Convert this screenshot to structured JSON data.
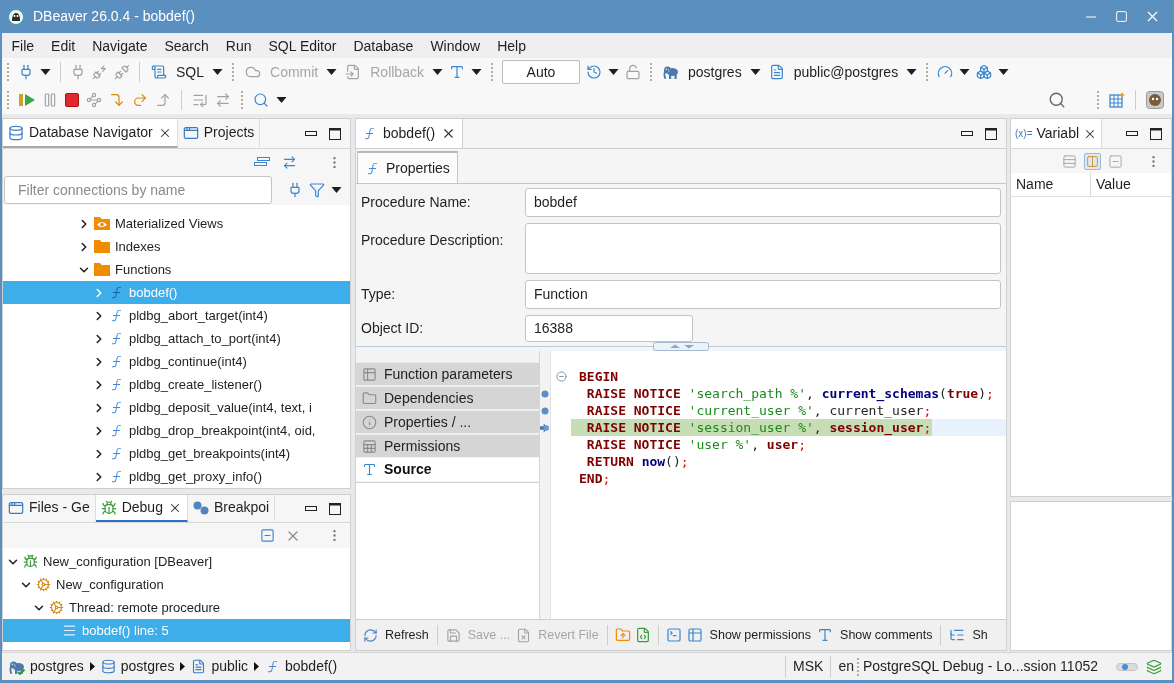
{
  "window": {
    "title": "DBeaver 26.0.4 - bobdef()"
  },
  "menu": [
    "File",
    "Edit",
    "Navigate",
    "Search",
    "Run",
    "SQL Editor",
    "Database",
    "Window",
    "Help"
  ],
  "toolbar": {
    "editor": {
      "label": "SQL"
    },
    "commit": {
      "label": "Commit",
      "disabled": true
    },
    "rollback": {
      "label": "Rollback",
      "disabled": true
    },
    "transaction_mode": {
      "value": "Auto"
    },
    "datasource": {
      "label": "postgres"
    },
    "schema": {
      "label": "public@postgres"
    }
  },
  "navigator": {
    "focused": false,
    "tabs": [
      {
        "label": "Database Navigator",
        "selected": true,
        "closable": true
      },
      {
        "label": "Projects",
        "selected": false,
        "closable": false
      }
    ],
    "filter": {
      "placeholder": "Filter connections by name"
    },
    "tree": [
      {
        "label": "Materialized Views",
        "kind": "view-folder",
        "expanded": false,
        "selected": false
      },
      {
        "label": "Indexes",
        "kind": "folder",
        "expanded": false,
        "selected": false
      },
      {
        "label": "Functions",
        "kind": "folder",
        "expanded": true,
        "selected": false,
        "children": [
          {
            "label": "bobdef()",
            "kind": "function",
            "expanded": false,
            "selected": true
          },
          {
            "label": "pldbg_abort_target(int4)",
            "kind": "function",
            "expanded": false,
            "selected": false
          },
          {
            "label": "pldbg_attach_to_port(int4)",
            "kind": "function",
            "expanded": false,
            "selected": false
          },
          {
            "label": "pldbg_continue(int4)",
            "kind": "function",
            "expanded": false,
            "selected": false
          },
          {
            "label": "pldbg_create_listener()",
            "kind": "function",
            "expanded": false,
            "selected": false
          },
          {
            "label": "pldbg_deposit_value(int4, text, i",
            "kind": "function",
            "expanded": false,
            "selected": false
          },
          {
            "label": "pldbg_drop_breakpoint(int4, oid,",
            "kind": "function",
            "expanded": false,
            "selected": false
          },
          {
            "label": "pldbg_get_breakpoints(int4)",
            "kind": "function",
            "expanded": false,
            "selected": false
          },
          {
            "label": "pldbg_get_proxy_info()",
            "kind": "function",
            "expanded": false,
            "selected": false
          }
        ]
      }
    ]
  },
  "debug": {
    "focused": true,
    "tabs": [
      {
        "label": "Files - Ge",
        "selected": false,
        "closable": false
      },
      {
        "label": "Debug",
        "selected": true,
        "closable": true
      },
      {
        "label": "Breakpoi",
        "selected": false,
        "closable": false
      }
    ],
    "tree": [
      {
        "label": "New_configuration [DBeaver]",
        "kind": "launch",
        "expanded": true,
        "selected": false,
        "children": [
          {
            "label": "New_configuration",
            "kind": "target",
            "expanded": true,
            "selected": false,
            "children": [
              {
                "label": "Thread: remote procedure",
                "kind": "thread",
                "expanded": true,
                "selected": false,
                "children": [
                  {
                    "label": "bobdef() line: 5",
                    "kind": "frame",
                    "selected": true
                  }
                ]
              }
            ]
          }
        ]
      }
    ]
  },
  "editor": {
    "tab": {
      "label": "bobdef()",
      "closable": true
    },
    "subtabs": [
      {
        "label": "Properties",
        "selected": true
      }
    ],
    "form": [
      {
        "label": "Procedure Name:",
        "kind": "text",
        "value": "bobdef"
      },
      {
        "label": "Procedure Description:",
        "kind": "textarea"
      },
      {
        "label": "Type:",
        "kind": "text",
        "value": "Function"
      },
      {
        "label": "Object ID:",
        "kind": "short",
        "value": "16388"
      }
    ],
    "sections": [
      {
        "label": "Function parameters",
        "kind": "parameters",
        "selected": false
      },
      {
        "label": "Dependencies",
        "kind": "dependencies",
        "selected": false
      },
      {
        "label": "Properties / ...",
        "kind": "properties",
        "selected": false
      },
      {
        "label": "Permissions",
        "kind": "permissions",
        "selected": false
      },
      {
        "label": "Source",
        "kind": "source",
        "selected": true
      }
    ],
    "code": [
      {
        "fold": true,
        "breakpoint": false,
        "current": false,
        "caret": false,
        "tokens": [
          {
            "text": "BEGIN",
            "kind": "keyword"
          }
        ]
      },
      {
        "fold": false,
        "breakpoint": true,
        "current": false,
        "caret": false,
        "tokens": [
          {
            "text": " RAISE NOTICE ",
            "kind": "keyword"
          },
          {
            "text": "'search_path %'",
            "kind": "string"
          },
          {
            "text": ", ",
            "kind": "plain"
          },
          {
            "text": "current_schemas",
            "kind": "function"
          },
          {
            "text": "(",
            "kind": "plain"
          },
          {
            "text": "true",
            "kind": "keyword"
          },
          {
            "text": ")",
            "kind": "plain"
          },
          {
            "text": ";",
            "kind": "punct"
          }
        ]
      },
      {
        "fold": false,
        "breakpoint": true,
        "current": false,
        "caret": false,
        "tokens": [
          {
            "text": " RAISE NOTICE ",
            "kind": "keyword"
          },
          {
            "text": "'current_user %'",
            "kind": "string"
          },
          {
            "text": ", current_user",
            "kind": "plain"
          },
          {
            "text": ";",
            "kind": "punct"
          }
        ]
      },
      {
        "fold": false,
        "breakpoint": true,
        "current": true,
        "caret": true,
        "tokens": [
          {
            "text": " RAISE NOTICE ",
            "kind": "keyword"
          },
          {
            "text": "'session_user %'",
            "kind": "string"
          },
          {
            "text": ", ",
            "kind": "plain"
          },
          {
            "text": "session_user",
            "kind": "keyword"
          },
          {
            "text": ";",
            "kind": "punct"
          }
        ]
      },
      {
        "fold": false,
        "breakpoint": false,
        "current": false,
        "caret": false,
        "tokens": [
          {
            "text": " RAISE NOTICE ",
            "kind": "keyword"
          },
          {
            "text": "'user %'",
            "kind": "string"
          },
          {
            "text": ", ",
            "kind": "plain"
          },
          {
            "text": "user",
            "kind": "keyword"
          },
          {
            "text": ";",
            "kind": "punct"
          }
        ]
      },
      {
        "fold": false,
        "breakpoint": false,
        "current": false,
        "caret": false,
        "tokens": [
          {
            "text": " RETURN ",
            "kind": "keyword"
          },
          {
            "text": "now",
            "kind": "function"
          },
          {
            "text": "()",
            "kind": "plain"
          },
          {
            "text": ";",
            "kind": "punct"
          }
        ]
      },
      {
        "fold": false,
        "breakpoint": false,
        "current": false,
        "caret": false,
        "tokens": [
          {
            "text": "END",
            "kind": "keyword"
          },
          {
            "text": ";",
            "kind": "punct"
          }
        ]
      }
    ],
    "actions": {
      "refresh": {
        "label": "Refresh",
        "disabled": false
      },
      "save": {
        "label": "Save ...",
        "disabled": true
      },
      "revert": {
        "label": "Revert File",
        "disabled": true
      },
      "permissions": {
        "label": "Show permissions"
      },
      "comments": {
        "label": "Show comments"
      },
      "last_item": {
        "label": "Sh"
      }
    }
  },
  "variables": {
    "icon_text": "(x)=",
    "tab": {
      "label": "Variabl",
      "closable": true
    },
    "toolbar": [
      {
        "pressed": false
      },
      {
        "pressed": true
      },
      {
        "pressed": false
      }
    ],
    "columns": [
      "Name",
      "Value"
    ]
  },
  "status_bar": {
    "path": [
      {
        "label": "postgres",
        "kind": "connection"
      },
      {
        "label": "postgres",
        "kind": "database"
      },
      {
        "label": "public",
        "kind": "schema"
      },
      {
        "label": "bobdef()",
        "kind": "function"
      }
    ],
    "timezone": "MSK",
    "locale": "en",
    "task": "PostgreSQL Debug - Lo...ssion 11052"
  }
}
